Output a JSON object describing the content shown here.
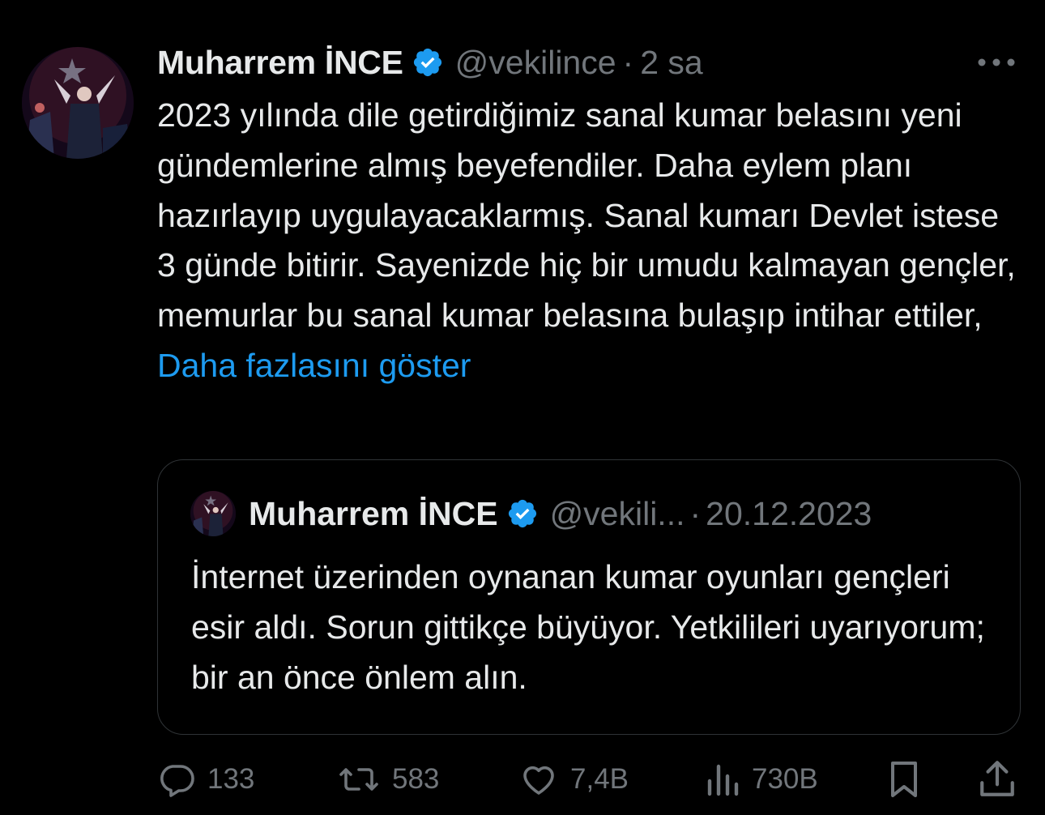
{
  "author": {
    "name": "Muharrem İNCE",
    "handle": "@vekilince",
    "separator": "·",
    "time": "2 sa"
  },
  "tweet": {
    "text": "2023 yılında dile getirdiğimiz sanal kumar belasını yeni gündemlerine almış beyefendiler. Daha eylem planı hazırlayıp uygulayacaklarmış. Sanal kumarı Devlet istese 3 günde bitirir. Sayenizde hiç bir umudu kalmayan gençler, memurlar bu sanal kumar belasına bulaşıp intihar ettiler, ",
    "show_more": "Daha fazlasını göster"
  },
  "quoted": {
    "name": "Muharrem İNCE",
    "handle": "@vekili...",
    "separator": "·",
    "date": "20.12.2023",
    "text": "İnternet üzerinden oynanan kumar oyunları gençleri esir aldı. Sorun gittikçe büyüyor. Yetkilileri uyarıyorum; bir an önce önlem alın."
  },
  "actions": {
    "replies": "133",
    "reposts": "583",
    "likes": "7,4B",
    "views": "730B"
  },
  "icons": {
    "verified": "verified-badge-icon",
    "more": "more-dots-icon",
    "reply": "reply-icon",
    "repost": "repost-icon",
    "like": "heart-icon",
    "views": "views-chart-icon",
    "bookmark": "bookmark-icon",
    "share": "share-icon"
  },
  "colors": {
    "background": "#000000",
    "text": "#e7e9ea",
    "muted": "#71767b",
    "link": "#1d9bf0",
    "verified": "#1d9bf0",
    "border": "#2f3336"
  }
}
